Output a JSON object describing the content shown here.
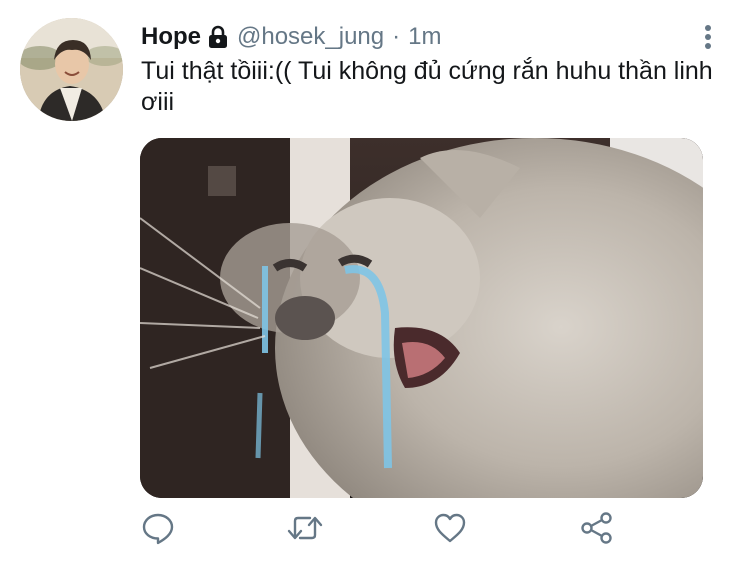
{
  "tweet": {
    "author": {
      "display_name": "Hope",
      "handle": "@hosek_jung",
      "protected_icon": "lock-icon"
    },
    "separator": "·",
    "timestamp": "1m",
    "text": "Tui thật tồiii:(( Tui không đủ cứng rắn huhu thần linh ơiii",
    "media": {
      "kind": "image",
      "description_icon": "crying-cat-photo"
    }
  },
  "actions": [
    {
      "name": "reply",
      "icon": "reply-icon"
    },
    {
      "name": "retweet",
      "icon": "retweet-icon"
    },
    {
      "name": "like",
      "icon": "heart-icon"
    },
    {
      "name": "share",
      "icon": "share-icon"
    }
  ],
  "colors": {
    "text": "#14171a",
    "secondary": "#657786",
    "icon": "#657786"
  }
}
